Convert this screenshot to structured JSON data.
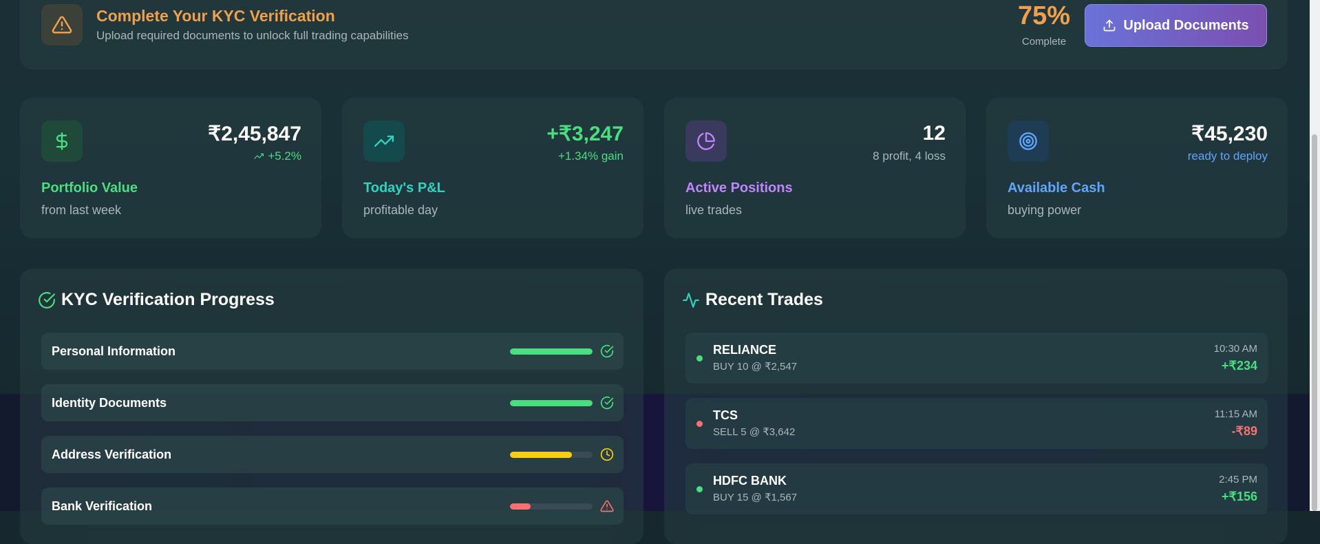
{
  "kyc_banner": {
    "title": "Complete Your KYC Verification",
    "subtitle": "Upload required documents to unlock full trading capabilities",
    "percent": "75%",
    "percent_label": "Complete",
    "button_label": "Upload Documents",
    "icon": "warning-icon"
  },
  "stats": [
    {
      "value": "₹2,45,847",
      "delta": "+5.2%",
      "label": "Portfolio Value",
      "sub": "from last week",
      "icon": "dollar-icon",
      "accent": "#4ade80"
    },
    {
      "value": "+₹3,247",
      "delta": "+1.34% gain",
      "label": "Today's P&L",
      "sub": "profitable day",
      "icon": "trending-up-icon",
      "accent": "#2dd4bf"
    },
    {
      "value": "12",
      "delta": "8 profit, 4 loss",
      "label": "Active Positions",
      "sub": "live trades",
      "icon": "pie-chart-icon",
      "accent": "#c084fc"
    },
    {
      "value": "₹45,230",
      "delta": "ready to deploy",
      "label": "Available Cash",
      "sub": "buying power",
      "icon": "target-icon",
      "accent": "#60a5fa"
    }
  ],
  "kyc_progress": {
    "title": "KYC Verification Progress",
    "steps": [
      {
        "name": "Personal Information",
        "progress": 1.0,
        "status": "complete",
        "color": "#4ade80"
      },
      {
        "name": "Identity Documents",
        "progress": 1.0,
        "status": "complete",
        "color": "#4ade80"
      },
      {
        "name": "Address Verification",
        "progress": 0.75,
        "status": "pending",
        "color": "#facc15"
      },
      {
        "name": "Bank Verification",
        "progress": 0.25,
        "status": "warning",
        "color": "#f87171"
      }
    ]
  },
  "recent_trades": {
    "title": "Recent Trades",
    "trades": [
      {
        "symbol": "RELIANCE",
        "detail": "BUY 10 @ ₹2,547",
        "time": "10:30 AM",
        "pnl": "+₹234",
        "positive": true
      },
      {
        "symbol": "TCS",
        "detail": "SELL 5 @ ₹3,642",
        "time": "11:15 AM",
        "pnl": "-₹89",
        "positive": false
      },
      {
        "symbol": "HDFC BANK",
        "detail": "BUY 15 @ ₹1,567",
        "time": "2:45 PM",
        "pnl": "+₹156",
        "positive": true
      }
    ]
  },
  "colors": {
    "orange": "#f0a04b",
    "green": "#4ade80",
    "red": "#f87171",
    "teal": "#2dd4bf",
    "purple": "#c084fc",
    "blue": "#60a5fa"
  }
}
